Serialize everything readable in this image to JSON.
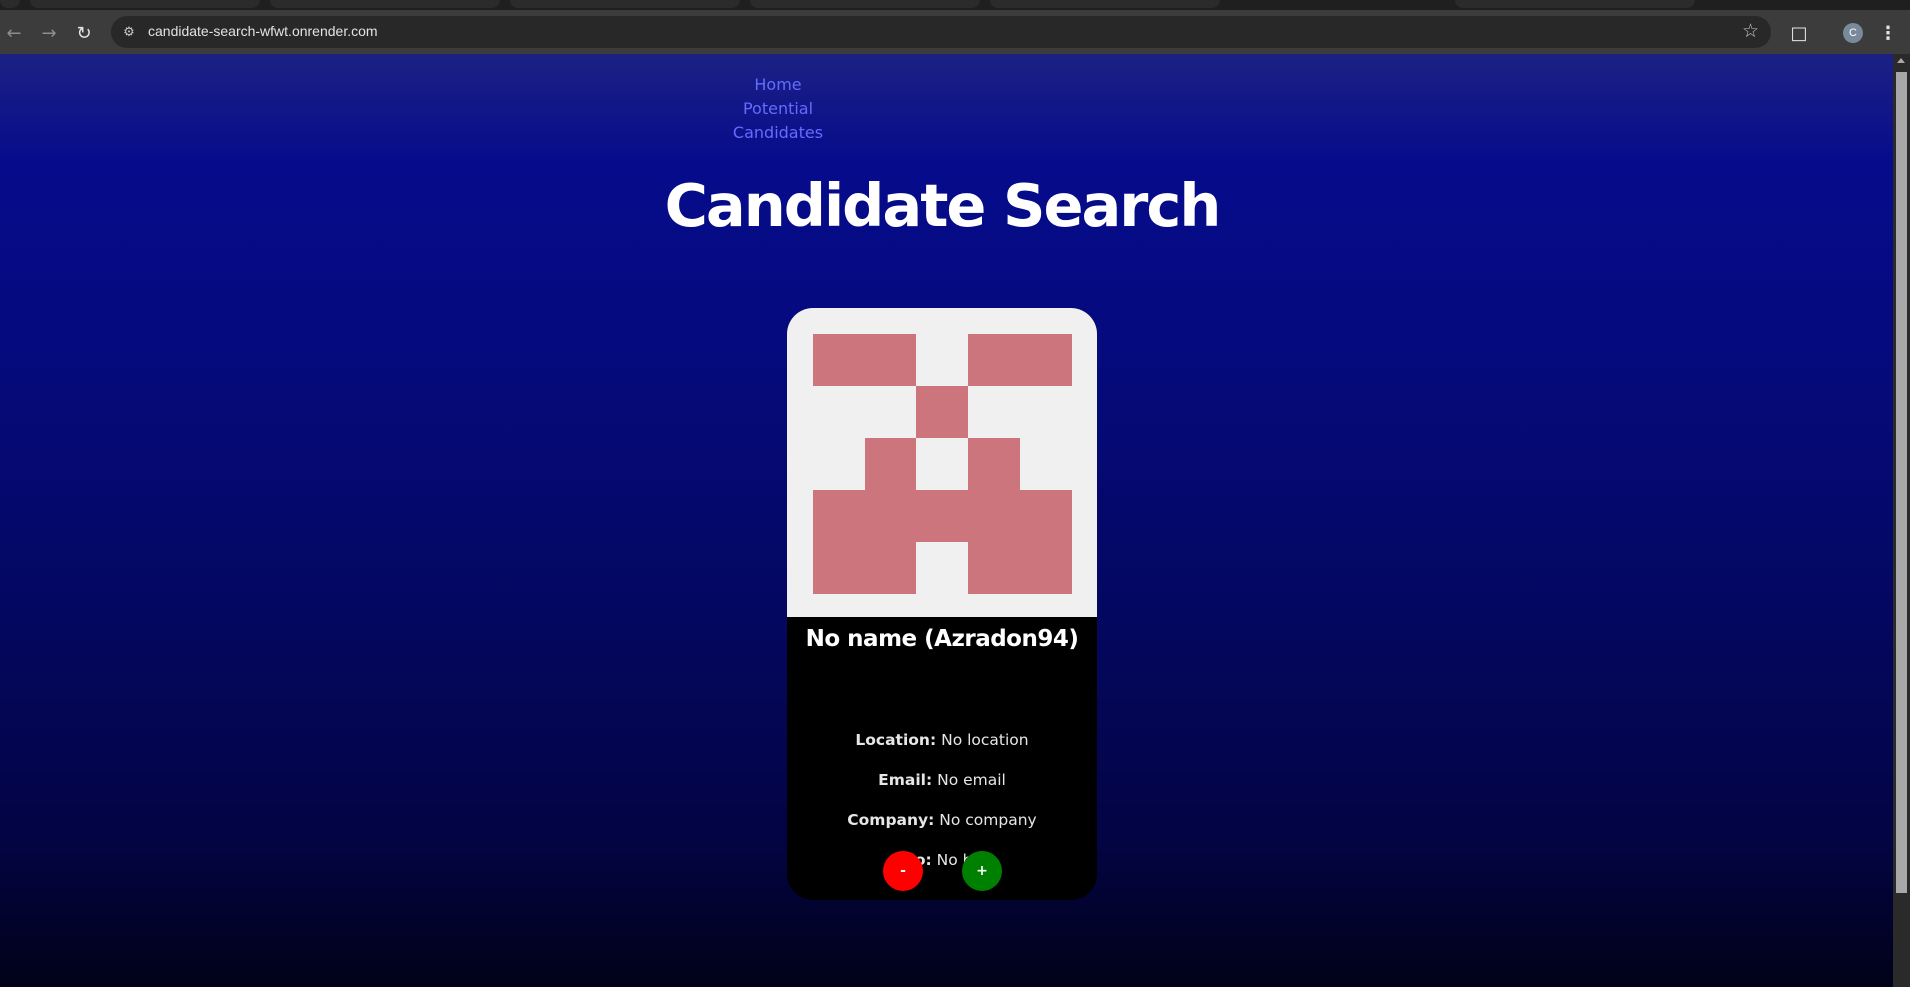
{
  "browser": {
    "url": "candidate-search-wfwt.onrender.com",
    "profile_initial": "C"
  },
  "nav": {
    "home_label": "Home",
    "potential_label_line1": "Potential",
    "potential_label_line2": "Candidates"
  },
  "page": {
    "title": "Candidate Search"
  },
  "candidate": {
    "name": "No name (Azradon94)",
    "location_label": "Location:",
    "location_value": "No location",
    "email_label": "Email:",
    "email_value": "No email",
    "company_label": "Company:",
    "company_value": "No company",
    "bio_label": "Bio:",
    "bio_value": "No bio",
    "avatar_color": "#cc757d"
  },
  "actions": {
    "reject_label": "-",
    "accept_label": "+",
    "reject_color": "#ff0000",
    "accept_color": "#008000"
  },
  "icons": {
    "back": "back-arrow-icon",
    "forward": "forward-arrow-icon",
    "reload": "reload-icon",
    "site_info": "site-info-icon",
    "bookmark": "star-icon",
    "extensions": "puzzle-icon",
    "menu": "kebab-menu-icon"
  }
}
